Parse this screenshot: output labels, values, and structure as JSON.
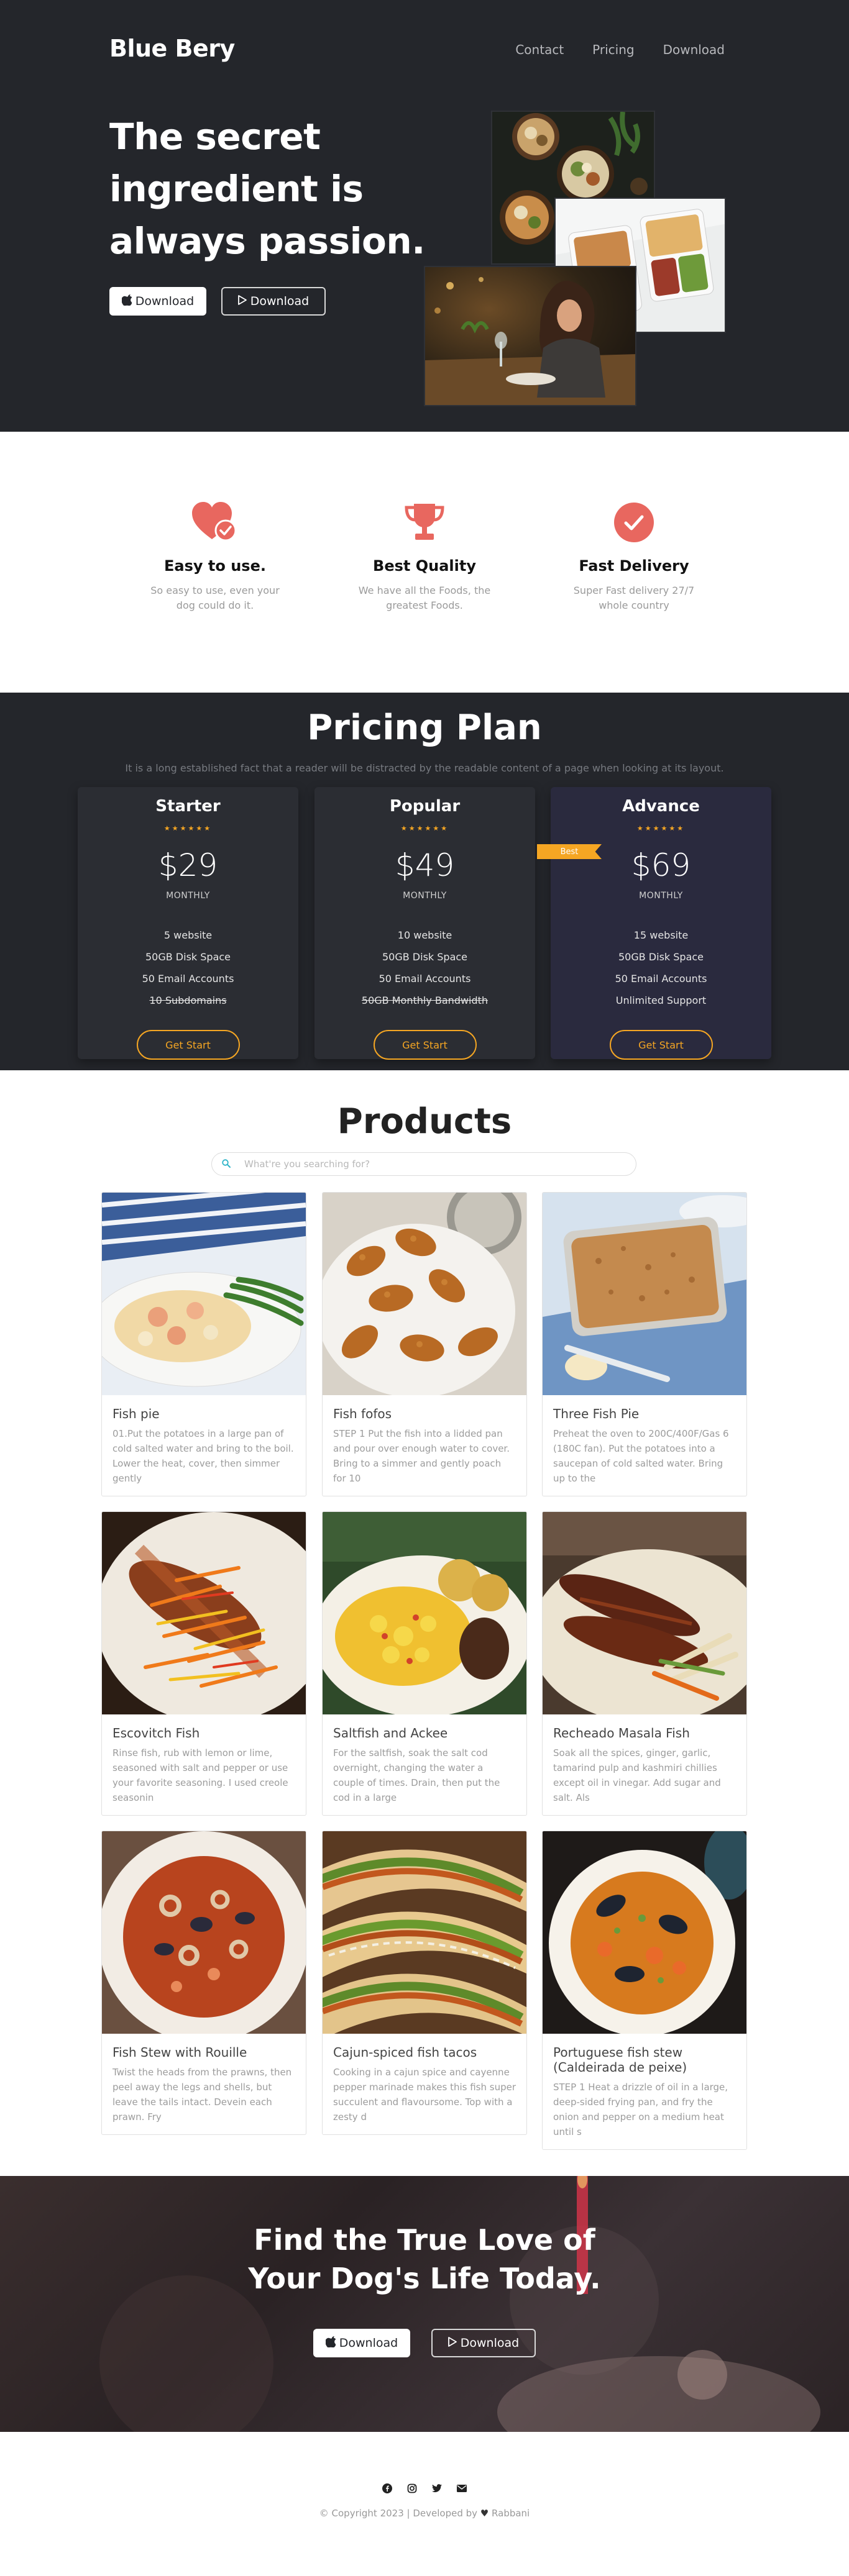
{
  "nav": {
    "brand": "Blue Bery",
    "links": [
      "Contact",
      "Pricing",
      "Download"
    ]
  },
  "hero": {
    "title": "The secret ingredient is always passion.",
    "buttons": [
      {
        "icon": "apple-icon",
        "label": "Download"
      },
      {
        "icon": "play-icon",
        "label": "Download"
      }
    ]
  },
  "features": [
    {
      "icon": "heart-check-icon",
      "title": "Easy to use.",
      "text": "So easy to use, even your dog could do it."
    },
    {
      "icon": "trophy-icon",
      "title": "Best Quality",
      "text": "We have all the Foods, the greatest Foods."
    },
    {
      "icon": "check-circle-icon",
      "title": "Fast Delivery",
      "text": "Super Fast delivery 27/7 whole country"
    }
  ],
  "pricing": {
    "title": "Pricing Plan",
    "subtitle": "It is a long established fact that a reader will be distracted by the readable content of a page when looking at its layout.",
    "plans": [
      {
        "name": "Starter",
        "stars": "★★★★★★",
        "price": "$29",
        "period": "MONTHLY",
        "features": [
          "5 website",
          "50GB Disk Space",
          "50 Email Accounts",
          "10 Subdomains"
        ],
        "struck": [
          false,
          false,
          false,
          true
        ],
        "cta": "Get Start"
      },
      {
        "name": "Popular",
        "stars": "★★★★★★",
        "price": "$49",
        "period": "MONTHLY",
        "features": [
          "10 website",
          "50GB Disk Space",
          "50 Email Accounts",
          "50GB Monthly Bandwidth"
        ],
        "struck": [
          false,
          false,
          false,
          true
        ],
        "cta": "Get Start"
      },
      {
        "name": "Advance",
        "stars": "★★★★★★",
        "price": "$69",
        "period": "MONTHLY",
        "badge": "Best",
        "features": [
          "15 website",
          "50GB Disk Space",
          "50 Email Accounts",
          "Unlimited Support"
        ],
        "struck": [
          false,
          false,
          false,
          false
        ],
        "cta": "Get Start"
      }
    ],
    "accent": "#f5a623"
  },
  "products": {
    "title": "Products",
    "search_placeholder": "What're you searching for?",
    "items": [
      {
        "name": "Fish pie",
        "desc": "01.Put the potatoes in a large pan of cold salted water and bring to the boil. Lower the heat, cover, then simmer gently"
      },
      {
        "name": "Fish fofos",
        "desc": "STEP 1 Put the fish into a lidded pan and pour over enough water to cover. Bring to a simmer and gently poach for 10"
      },
      {
        "name": "Three Fish Pie",
        "desc": "Preheat the oven to 200C/400F/Gas 6 (180C fan). Put the potatoes into a saucepan of cold salted water. Bring up to the"
      },
      {
        "name": "Escovitch Fish",
        "desc": "Rinse fish, rub with lemon or lime, seasoned with salt and pepper or use your favorite seasoning. I used creole seasonin"
      },
      {
        "name": "Saltfish and Ackee",
        "desc": "For the saltfish, soak the salt cod overnight, changing the water a couple of times. Drain, then put the cod in a large"
      },
      {
        "name": "Recheado Masala Fish",
        "desc": "Soak all the spices, ginger, garlic, tamarind pulp and kashmiri chillies except oil in vinegar. Add sugar and salt. Als"
      },
      {
        "name": "Fish Stew with Rouille",
        "desc": "Twist the heads from the prawns, then peel away the legs and shells, but leave the tails intact. Devein each prawn. Fry"
      },
      {
        "name": "Cajun-spiced fish tacos",
        "desc": "Cooking in a cajun spice and cayenne pepper marinade makes this fish super succulent and flavoursome. Top with a zesty d"
      },
      {
        "name": "Portuguese fish stew (Caldeirada de peixe)",
        "desc": "STEP 1 Heat a drizzle of oil in a large, deep-sided frying pan, and fry the onion and pepper on a medium heat until s"
      }
    ]
  },
  "cta": {
    "title": "Find the True Love of Your Dog's Life Today.",
    "buttons": [
      {
        "icon": "apple-icon",
        "label": "Download"
      },
      {
        "icon": "play-icon",
        "label": "Download"
      }
    ]
  },
  "footer": {
    "socials": [
      "facebook-icon",
      "instagram-icon",
      "twitter-icon",
      "email-icon"
    ],
    "copyright_pre": "© Copyright 2023 | Developed by",
    "author": "Rabbani"
  },
  "colors": {
    "dark": "#24262b",
    "feature_icon": "#e8675f",
    "search_icon": "#2db4c8"
  }
}
